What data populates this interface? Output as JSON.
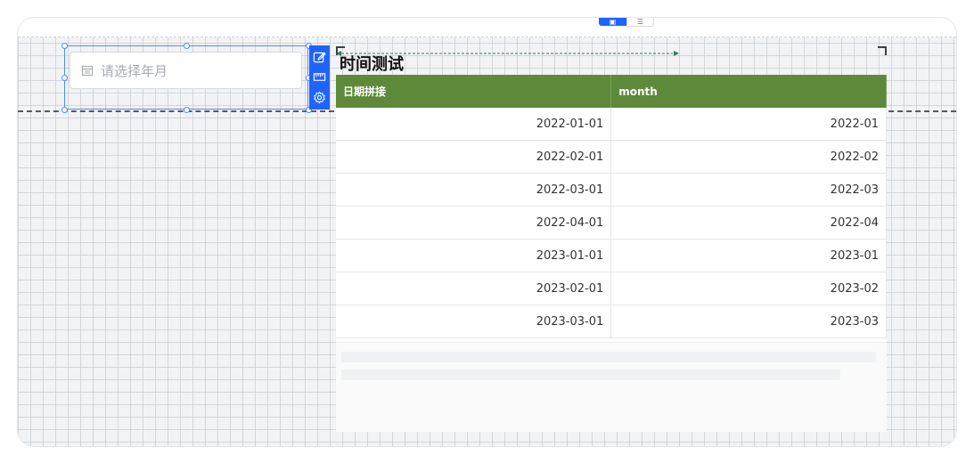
{
  "view_toggle": {
    "active": "▣",
    "inactive": "☰"
  },
  "picker": {
    "placeholder": "请选择年月",
    "icon": "calendar-icon"
  },
  "tools": [
    "edit-icon",
    "ruler-icon",
    "gear-icon"
  ],
  "table": {
    "title": "时间测试",
    "headers": [
      "日期拼接",
      "month"
    ],
    "rows": [
      [
        "2022-01-01",
        "2022-01"
      ],
      [
        "2022-02-01",
        "2022-02"
      ],
      [
        "2022-03-01",
        "2022-03"
      ],
      [
        "2022-04-01",
        "2022-04"
      ],
      [
        "2023-01-01",
        "2023-01"
      ],
      [
        "2023-02-01",
        "2023-02"
      ],
      [
        "2023-03-01",
        "2023-03"
      ]
    ],
    "header_color": "#5e893a"
  },
  "colors": {
    "accent": "#1f64ff",
    "selection": "#4d8cff"
  }
}
